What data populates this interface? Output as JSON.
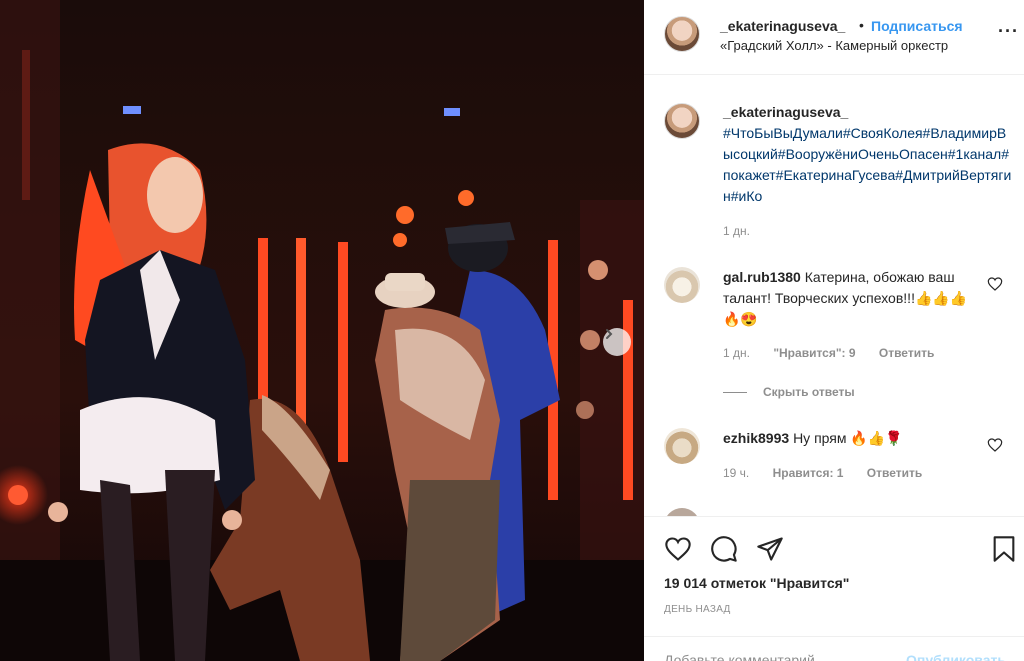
{
  "post": {
    "username": "_ekaterinaguseva_",
    "follow_label": "Подписаться",
    "location": "«Градский Холл» - Камерный оркестр",
    "more_icon": "more-dots-icon"
  },
  "caption": {
    "username": "_ekaterinaguseva_",
    "text": "#ЧтоБыВыДумали#СвояКолея#ВладимирВысоцкий#ВооружёниОченьОпасен#1канал#покажет#ЕкатеринаГусева#ДмитрийВертягин#иКо",
    "time": "1 дн."
  },
  "comments": [
    {
      "username": "gal.rub1380",
      "text": "Катерина, обожаю ваш талант! Творческих успехов!!!👍👍👍🔥😍",
      "time": "1 дн.",
      "likes": "\"Нравится\": 9",
      "reply": "Ответить"
    },
    {
      "username": "ezhik8993",
      "text": "Ну прям 🔥👍🌹",
      "time": "19 ч.",
      "likes": "Нравится: 1",
      "reply": "Ответить"
    }
  ],
  "hide_replies": "Скрыть ответы",
  "likes_count": "19 014 отметок \"Нравится\"",
  "timestamp": "ДЕНЬ НАЗАД",
  "add_comment": {
    "placeholder": "Добавьте комментарий...",
    "post_label": "Опубликовать"
  },
  "colors": {
    "link": "#3897f0",
    "hashtag": "#00376b",
    "muted": "#8e8e8e"
  }
}
